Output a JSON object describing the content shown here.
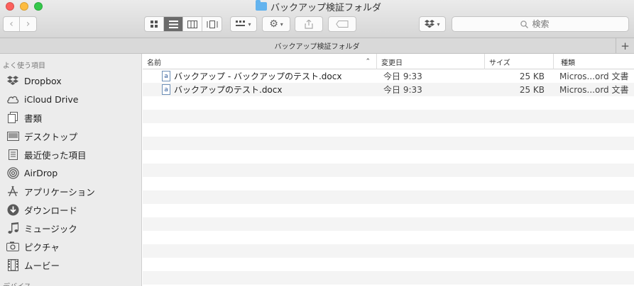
{
  "window": {
    "title": "バックアップ検証フォルダ",
    "path_title": "バックアップ検証フォルダ"
  },
  "search": {
    "placeholder": "検索"
  },
  "sidebar": {
    "section_favorites": "よく使う項目",
    "section_devices": "デバイス",
    "items": [
      {
        "label": "Dropbox",
        "icon": "dropbox-icon"
      },
      {
        "label": "iCloud Drive",
        "icon": "cloud-icon"
      },
      {
        "label": "書類",
        "icon": "documents-icon"
      },
      {
        "label": "デスクトップ",
        "icon": "desktop-icon"
      },
      {
        "label": "最近使った項目",
        "icon": "recents-icon"
      },
      {
        "label": "AirDrop",
        "icon": "airdrop-icon"
      },
      {
        "label": "アプリケーション",
        "icon": "applications-icon"
      },
      {
        "label": "ダウンロード",
        "icon": "download-icon"
      },
      {
        "label": "ミュージック",
        "icon": "music-icon"
      },
      {
        "label": "ピクチャ",
        "icon": "camera-icon"
      },
      {
        "label": "ムービー",
        "icon": "film-icon"
      }
    ]
  },
  "columns": {
    "name": "名前",
    "date": "変更日",
    "size": "サイズ",
    "kind": "種類"
  },
  "files": [
    {
      "name": "バックアップ - バックアップのテスト.docx",
      "date": "今日 9:33",
      "size": "25 KB",
      "kind": "Micros...ord 文書"
    },
    {
      "name": "バックアップのテスト.docx",
      "date": "今日 9:33",
      "size": "25 KB",
      "kind": "Micros...ord 文書"
    }
  ],
  "colors": {
    "close": "#fc605c",
    "minimize": "#fdbc40",
    "zoom": "#34c84a",
    "folder": "#63b3ee"
  }
}
